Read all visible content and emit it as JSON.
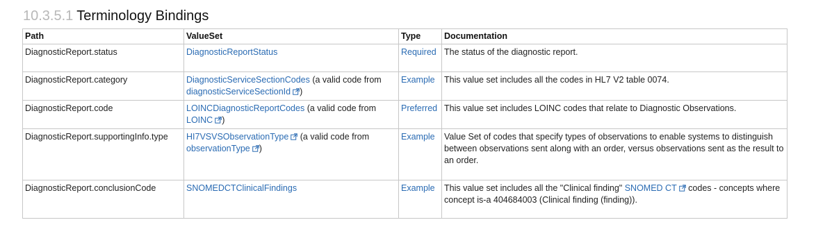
{
  "section": {
    "number": "10.3.5.1",
    "title": "Terminology Bindings"
  },
  "table": {
    "headers": {
      "path": "Path",
      "valueset": "ValueSet",
      "type": "Type",
      "documentation": "Documentation"
    },
    "rows": [
      {
        "path": "DiagnosticReport.status",
        "valueset_link": "DiagnosticReportStatus",
        "type": "Required",
        "documentation": "The status of the diagnostic report."
      },
      {
        "path": "DiagnosticReport.category",
        "valueset_link": "DiagnosticServiceSectionCodes",
        "valueset_mid": " (a valid code from ",
        "valueset_code_link": "diagnosticServiceSectionId",
        "valueset_end": ")",
        "type": "Example",
        "documentation": "This value set includes all the codes in HL7 V2 table 0074."
      },
      {
        "path": "DiagnosticReport.code",
        "valueset_link": "LOINCDiagnosticReportCodes",
        "valueset_mid": " (a valid code from ",
        "valueset_code_link": "LOINC",
        "valueset_end": ")",
        "type": "Preferred",
        "documentation": "This value set includes LOINC codes that relate to Diagnostic Observations."
      },
      {
        "path": "DiagnosticReport.supportingInfo.type",
        "valueset_link": "HI7VSVSObservationType",
        "valueset_mid": " (a valid code from ",
        "valueset_code_link": "observationType",
        "valueset_end": ")",
        "type": "Example",
        "documentation": "Value Set of codes that specify types of observations to enable systems to distinguish between observations sent along with an order, versus observations sent as the result to an order."
      },
      {
        "path": "DiagnosticReport.conclusionCode",
        "valueset_link": "SNOMEDCTClinicalFindings",
        "type": "Example",
        "documentation_pre": "This value set includes all the \"Clinical finding\" ",
        "documentation_link": "SNOMED CT",
        "documentation_post": " codes - concepts where concept is-a 404684003 (Clinical finding (finding))."
      }
    ]
  },
  "icons": {
    "external": "external-link-icon"
  },
  "colors": {
    "link": "#2a6bb3",
    "section_number": "#b8b8b8",
    "border": "#c7c7c7"
  }
}
